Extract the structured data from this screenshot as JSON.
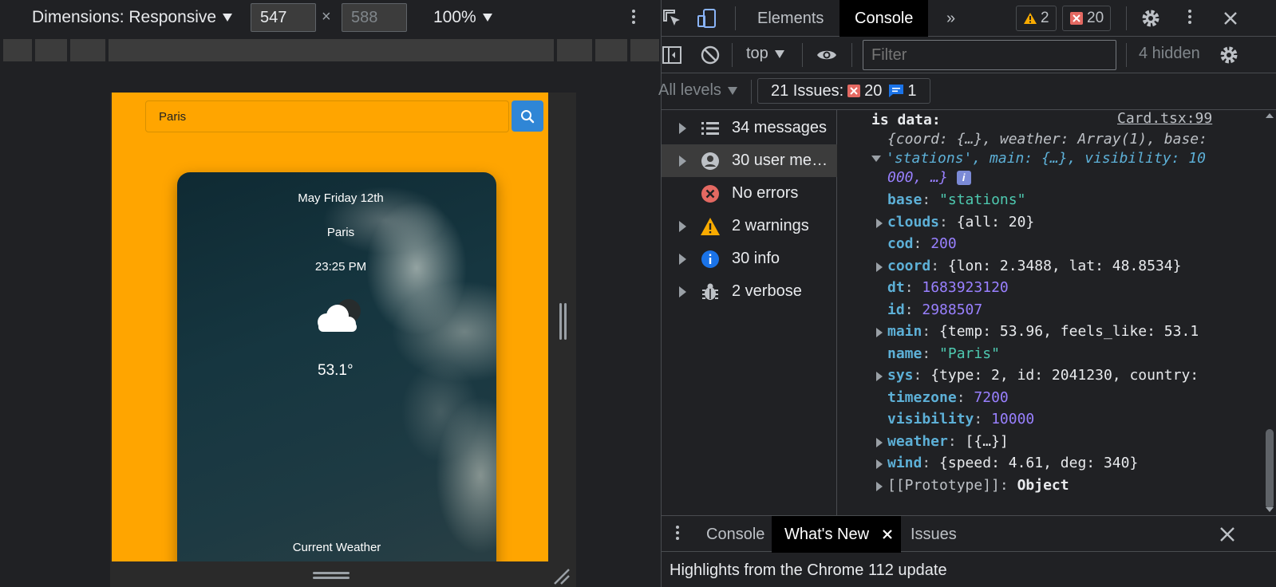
{
  "device_toolbar": {
    "dimensions_label": "Dimensions: Responsive",
    "width": "547",
    "height": "588",
    "times": "×",
    "zoom": "100%"
  },
  "app": {
    "search_value": "Paris",
    "card": {
      "date": "May Friday 12th",
      "city": "Paris",
      "time": "23:25 PM",
      "temperature": "53.1°",
      "label": "Current Weather",
      "icon": "cloud-icon"
    },
    "background_color": "#ffa500",
    "button_color": "#2f86d6"
  },
  "devtools": {
    "tabs": [
      "Elements",
      "Console"
    ],
    "active_tab": "Console",
    "more_tabs": "»",
    "warning_count": "2",
    "error_count": "20",
    "context": "top",
    "filter_placeholder": "Filter",
    "hidden_count": "4 hidden",
    "levels": "All levels",
    "issues_label": "21 Issues:",
    "issues_errors": "20",
    "issues_info": "1",
    "sidebar": [
      {
        "label": "34 messages",
        "icon": "list-icon",
        "expandable": true
      },
      {
        "label": "30 user mes…",
        "icon": "user-icon",
        "expandable": true
      },
      {
        "label": "No errors",
        "icon": "error-icon",
        "expandable": false
      },
      {
        "label": "2 warnings",
        "icon": "warning-icon",
        "expandable": true
      },
      {
        "label": "30 info",
        "icon": "info-icon",
        "expandable": true
      },
      {
        "label": "2 verbose",
        "icon": "bug-icon",
        "expandable": true
      }
    ],
    "console": {
      "header": "is data:",
      "source": "Card.tsx:99",
      "summary_1": "{coord: {…}, weather: Array(1), base:",
      "summary_2": "'stations', main: {…}, visibility: 10",
      "summary_3": "000, …}",
      "props": [
        {
          "key": "base",
          "value": "\"stations\"",
          "type": "string",
          "expandable": false
        },
        {
          "key": "clouds",
          "value": "{all: 20}",
          "type": "object",
          "expandable": true
        },
        {
          "key": "cod",
          "value": "200",
          "type": "number",
          "expandable": false
        },
        {
          "key": "coord",
          "value": "{lon: 2.3488, lat: 48.8534}",
          "type": "object",
          "expandable": true
        },
        {
          "key": "dt",
          "value": "1683923120",
          "type": "number",
          "expandable": false
        },
        {
          "key": "id",
          "value": "2988507",
          "type": "number",
          "expandable": false
        },
        {
          "key": "main",
          "value": "{temp: 53.96, feels_like: 53.1",
          "type": "object",
          "expandable": true
        },
        {
          "key": "name",
          "value": "\"Paris\"",
          "type": "string",
          "expandable": false
        },
        {
          "key": "sys",
          "value": "{type: 2, id: 2041230, country:",
          "type": "object",
          "expandable": true
        },
        {
          "key": "timezone",
          "value": "7200",
          "type": "number",
          "expandable": false
        },
        {
          "key": "visibility",
          "value": "10000",
          "type": "number",
          "expandable": false
        },
        {
          "key": "weather",
          "value": "[{…}]",
          "type": "object",
          "expandable": true
        },
        {
          "key": "wind",
          "value": "{speed: 4.61, deg: 340}",
          "type": "object",
          "expandable": true
        },
        {
          "key": "[[Prototype]]",
          "value": "Object",
          "type": "proto",
          "expandable": true
        }
      ]
    },
    "drawer": {
      "tabs": [
        "Console",
        "What's New",
        "Issues"
      ],
      "active": "What's New",
      "body": "Highlights from the Chrome 112 update"
    }
  }
}
